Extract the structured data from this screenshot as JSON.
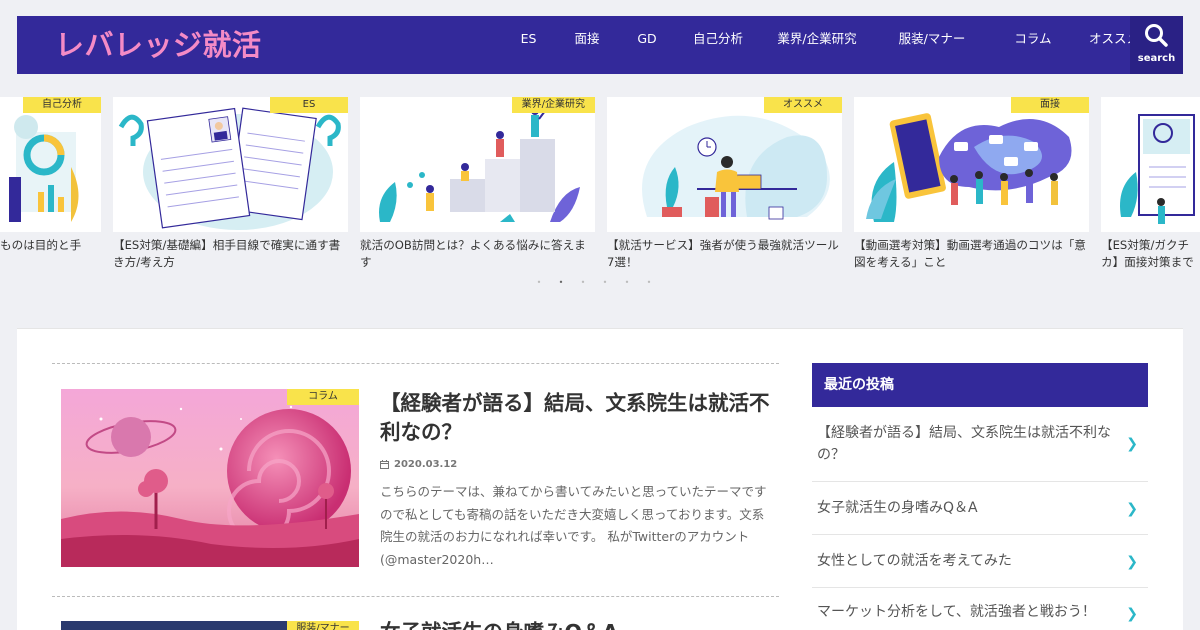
{
  "site": {
    "logo": "レバレッジ就活"
  },
  "nav": {
    "items": [
      "ES",
      "面接",
      "GD",
      "自己分析",
      "業界/企業研究",
      "服装/マナー",
      "コラム",
      "オススメ"
    ],
    "search_label": "search"
  },
  "carousel": {
    "cards": [
      {
        "tag": "自己分析",
        "title": "ものは目的と手"
      },
      {
        "tag": "ES",
        "title": "【ES対策/基礎編】相手目線で確実に通す書き方/考え方"
      },
      {
        "tag": "業界/企業研究",
        "title": "就活のOB訪問とは？よくある悩みに答えます"
      },
      {
        "tag": "オススメ",
        "title": "【就活サービス】強者が使う最強就活ツール7選！"
      },
      {
        "tag": "面接",
        "title": "【動画選考対策】動画選考通過のコツは「意図を考える」こと"
      },
      {
        "tag": "",
        "title": "【ES対策/ガクチカ】面接対策まで網"
      }
    ],
    "dots": [
      "•",
      "•",
      "•",
      "•",
      "•",
      "•"
    ]
  },
  "posts": [
    {
      "tag": "コラム",
      "title": "【経験者が語る】結局、文系院生は就活不利なの？",
      "date": "2020.03.12",
      "excerpt": "こちらのテーマは、兼ねてから書いてみたいと思っていたテーマですので私としても寄稿の話をいただき大変嬉しく思っております。文系院生の就活のお力になれれば幸いです。 私がTwitterのアカウント(@master2020h…"
    },
    {
      "tag": "服装/マナー",
      "title": "女子就活生の身嗜みQ＆A"
    }
  ],
  "sidebar": {
    "heading": "最近の投稿",
    "items": [
      "【経験者が語る】結局、文系院生は就活不利なの？",
      "女子就活生の身嗜みQ＆A",
      "女性としての就活を考えてみた",
      "マーケット分析をして、就活強者と戦おう！"
    ]
  },
  "colors": {
    "header": "#33299a",
    "logo": "#f48bc6",
    "tag": "#f9e34b",
    "chevron": "#2bb7c8"
  }
}
